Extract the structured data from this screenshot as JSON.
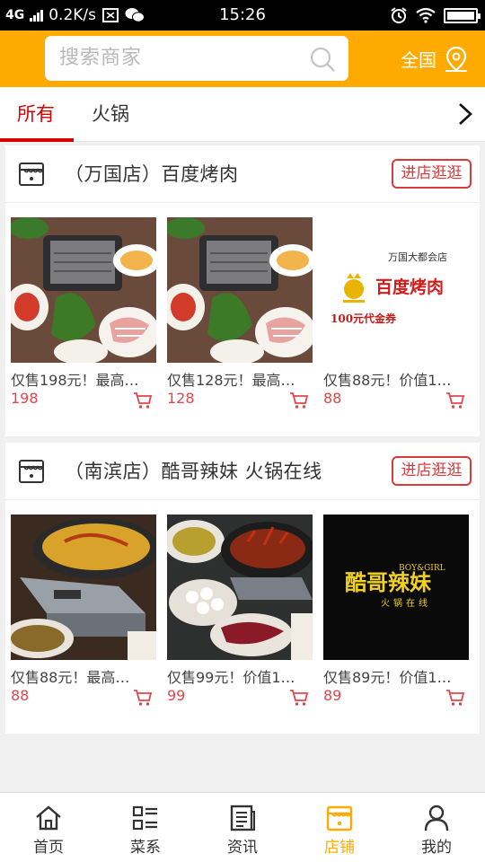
{
  "status_bar": {
    "network": "4G",
    "speed": "0.2K/s",
    "time": "15:26"
  },
  "header": {
    "search_placeholder": "搜索商家",
    "region_label": "全国"
  },
  "tabs": [
    {
      "label": "所有",
      "active": true
    },
    {
      "label": "火锅",
      "active": false
    }
  ],
  "stores": [
    {
      "name": "（万国店）百度烤肉",
      "enter_label": "进店逛逛",
      "items": [
        {
          "title": "仅售198元！最高…",
          "price": "198"
        },
        {
          "title": "仅售128元！最高…",
          "price": "128"
        },
        {
          "title": "仅售88元！价值1…",
          "price": "88",
          "coupon": {
            "store": "万国大都会店",
            "brand": "百度烤肉",
            "text": "100元代金券"
          }
        }
      ]
    },
    {
      "name": "（南滨店）酷哥辣妹 火锅在线",
      "enter_label": "进店逛逛",
      "items": [
        {
          "title": "仅售88元！最高…",
          "price": "88"
        },
        {
          "title": "仅售99元！价值1…",
          "price": "99"
        },
        {
          "title": "仅售89元！价值1…",
          "price": "89",
          "logo": {
            "main": "酷哥辣妹",
            "sub_en": "BOY&GIRL",
            "sub_cn": "火锅在线"
          }
        }
      ]
    }
  ],
  "bottom_nav": [
    {
      "label": "首页",
      "icon": "home-icon",
      "active": false
    },
    {
      "label": "菜系",
      "icon": "category-list-icon",
      "active": false
    },
    {
      "label": "资讯",
      "icon": "news-icon",
      "active": false
    },
    {
      "label": "店铺",
      "icon": "store-icon",
      "active": true
    },
    {
      "label": "我的",
      "icon": "user-icon",
      "active": false
    }
  ],
  "colors": {
    "brand": "#ffaa00",
    "accent_red": "#d40000",
    "price_red": "#e0474c"
  }
}
